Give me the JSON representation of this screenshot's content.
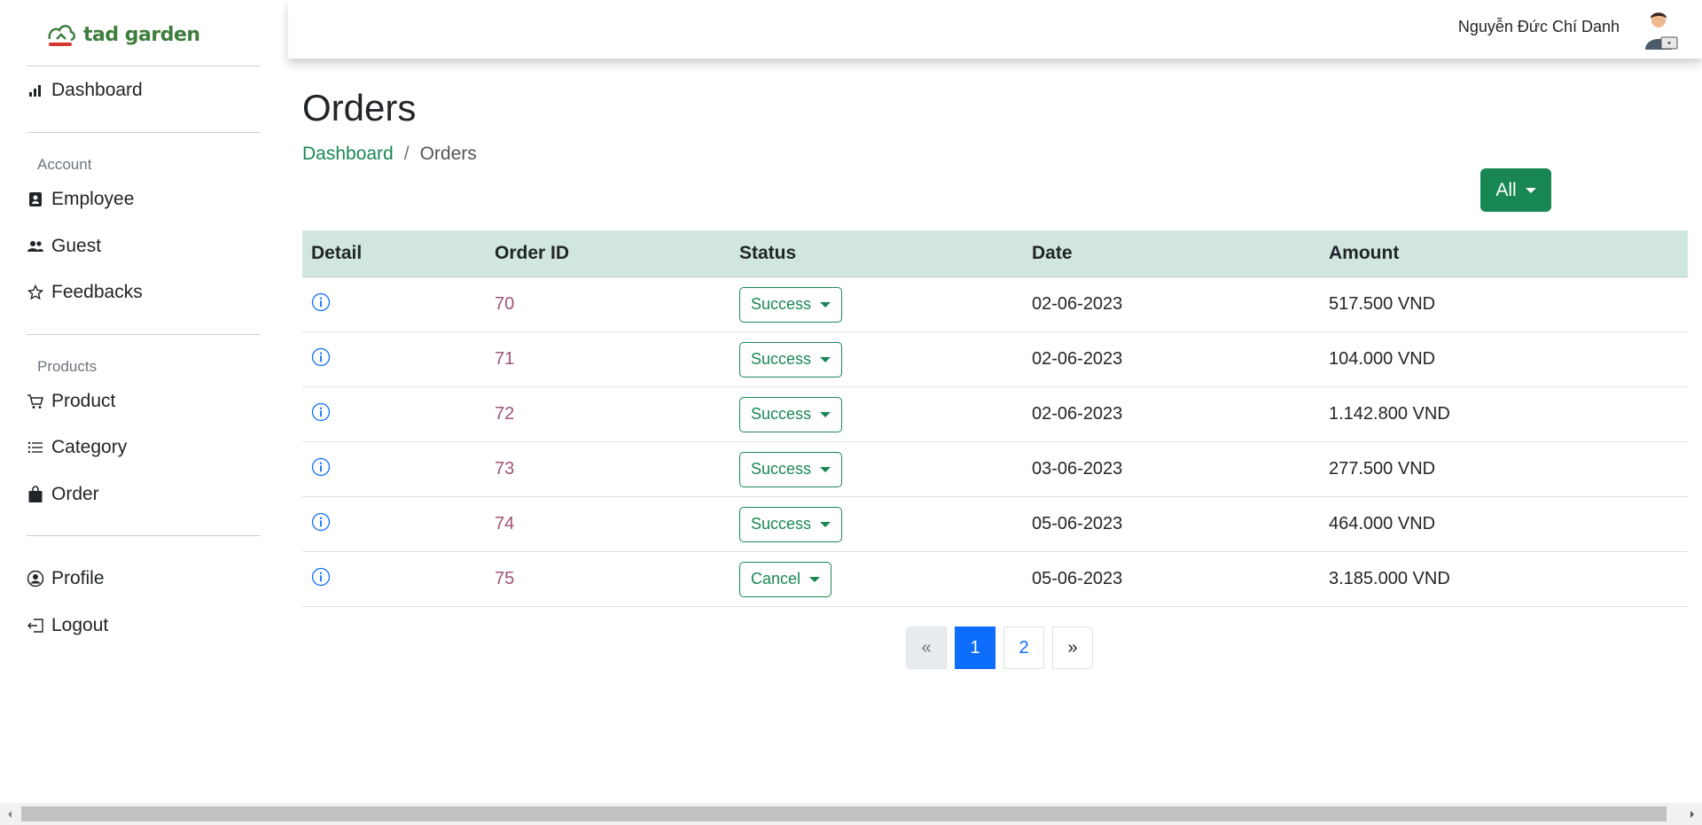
{
  "brand": {
    "name": "tad garden",
    "color": "#3f7d3f"
  },
  "header": {
    "user_name": "Nguyễn Đức Chí Danh"
  },
  "sidebar": {
    "dashboard": "Dashboard",
    "account_section": "Account",
    "employee": "Employee",
    "guest": "Guest",
    "feedbacks": "Feedbacks",
    "products_section": "Products",
    "product": "Product",
    "category": "Category",
    "order": "Order",
    "profile": "Profile",
    "logout": "Logout"
  },
  "main": {
    "title": "Orders",
    "breadcrumb": {
      "link": "Dashboard",
      "separator": "/",
      "current": "Orders"
    },
    "filter_label": "All",
    "columns": {
      "detail": "Detail",
      "order_id": "Order ID",
      "status": "Status",
      "date": "Date",
      "amount": "Amount"
    },
    "rows": [
      {
        "id": "70",
        "status": "Success",
        "date": "02-06-2023",
        "amount": "517.500 VND"
      },
      {
        "id": "71",
        "status": "Success",
        "date": "02-06-2023",
        "amount": "104.000 VND"
      },
      {
        "id": "72",
        "status": "Success",
        "date": "02-06-2023",
        "amount": "1.142.800 VND"
      },
      {
        "id": "73",
        "status": "Success",
        "date": "03-06-2023",
        "amount": "277.500 VND"
      },
      {
        "id": "74",
        "status": "Success",
        "date": "05-06-2023",
        "amount": "464.000 VND"
      },
      {
        "id": "75",
        "status": "Cancel",
        "date": "05-06-2023",
        "amount": "3.185.000 VND"
      }
    ],
    "pagination": {
      "prev": "«",
      "pages": [
        "1",
        "2"
      ],
      "next": "»",
      "active_page": "1"
    }
  },
  "colors": {
    "accent": "#198754",
    "header_row": "#d1e7dd",
    "link": "#0d6efd",
    "order_id": "#a0527a"
  }
}
